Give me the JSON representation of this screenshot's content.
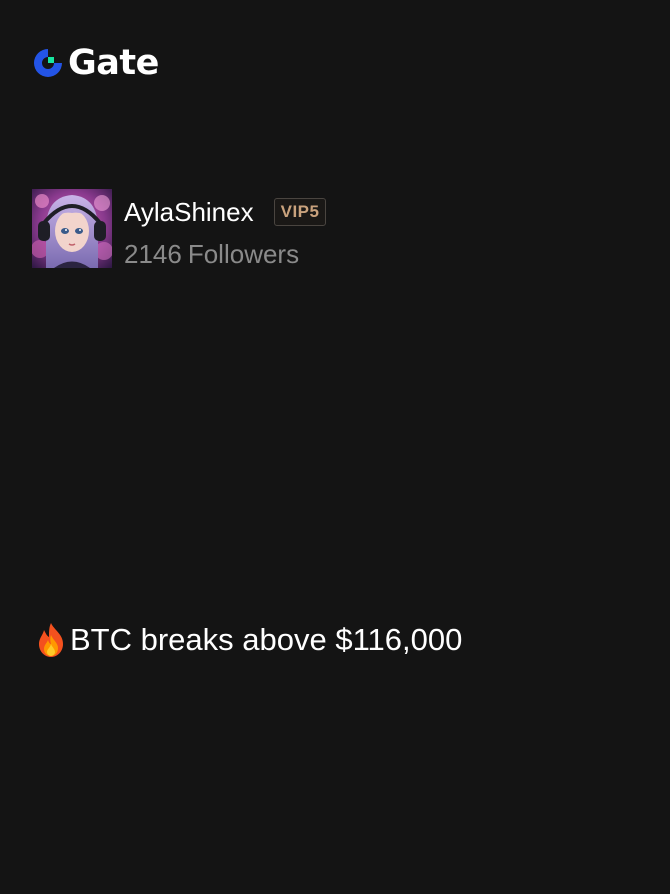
{
  "brand": {
    "name": "Gate",
    "icon": "gate-logo-icon",
    "colors": {
      "blue": "#2354e6",
      "green": "#17e6a1"
    }
  },
  "profile": {
    "username": "AylaShinex",
    "vip_badge": "VIP5",
    "followers_count": "2146",
    "followers_label": "Followers",
    "avatar_icon": "avatar-illustration"
  },
  "post": {
    "icon": "fire-icon",
    "headline": "BTC breaks above $116,000"
  }
}
